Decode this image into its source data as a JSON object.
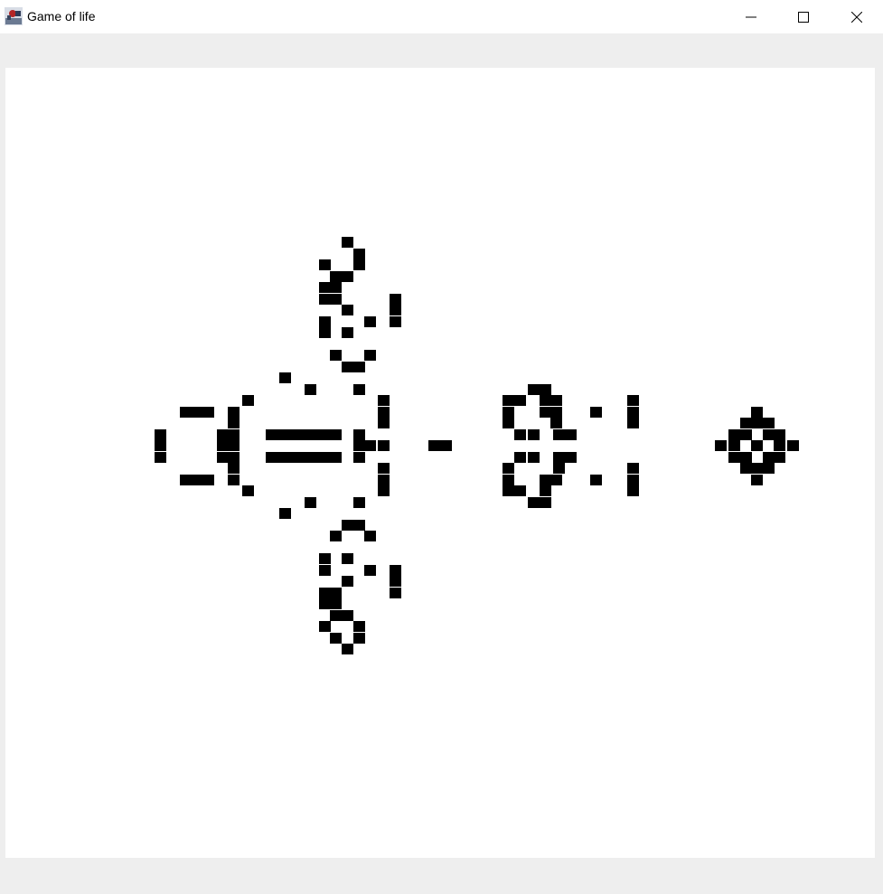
{
  "window": {
    "title": "Game of life",
    "icon": "java-app-icon",
    "controls": [
      "minimize-icon",
      "maximize-icon",
      "close-icon"
    ]
  },
  "board": {
    "live_color": "#000000",
    "dead_color": "#ffffff",
    "live_cells": [
      [
        384,
        268
      ],
      [
        359,
        293
      ],
      [
        397,
        281
      ],
      [
        397,
        293
      ],
      [
        371,
        306
      ],
      [
        384,
        306
      ],
      [
        359,
        318
      ],
      [
        359,
        331
      ],
      [
        371,
        318
      ],
      [
        371,
        331
      ],
      [
        384,
        343
      ],
      [
        359,
        356
      ],
      [
        359,
        368
      ],
      [
        384,
        368
      ],
      [
        409,
        356
      ],
      [
        437,
        331
      ],
      [
        437,
        343
      ],
      [
        437,
        356
      ],
      [
        371,
        393
      ],
      [
        384,
        406
      ],
      [
        397,
        406
      ],
      [
        409,
        393
      ],
      [
        315,
        418
      ],
      [
        343,
        431
      ],
      [
        397,
        431
      ],
      [
        274,
        443
      ],
      [
        424,
        443
      ],
      [
        424,
        456
      ],
      [
        424,
        468
      ],
      [
        205,
        456
      ],
      [
        218,
        456
      ],
      [
        230,
        456
      ],
      [
        258,
        456
      ],
      [
        258,
        468
      ],
      [
        177,
        481
      ],
      [
        177,
        493
      ],
      [
        177,
        506
      ],
      [
        246,
        481
      ],
      [
        258,
        481
      ],
      [
        246,
        493
      ],
      [
        258,
        493
      ],
      [
        246,
        506
      ],
      [
        258,
        506
      ],
      [
        300,
        481
      ],
      [
        312,
        481
      ],
      [
        324,
        481
      ],
      [
        336,
        481
      ],
      [
        348,
        481
      ],
      [
        360,
        481
      ],
      [
        371,
        481
      ],
      [
        300,
        506
      ],
      [
        312,
        506
      ],
      [
        324,
        506
      ],
      [
        336,
        506
      ],
      [
        348,
        506
      ],
      [
        360,
        506
      ],
      [
        371,
        506
      ],
      [
        397,
        481
      ],
      [
        397,
        493
      ],
      [
        397,
        506
      ],
      [
        409,
        493
      ],
      [
        424,
        493
      ],
      [
        480,
        493
      ],
      [
        493,
        493
      ],
      [
        205,
        531
      ],
      [
        218,
        531
      ],
      [
        230,
        531
      ],
      [
        258,
        518
      ],
      [
        258,
        531
      ],
      [
        274,
        543
      ],
      [
        424,
        518
      ],
      [
        424,
        531
      ],
      [
        424,
        543
      ],
      [
        343,
        556
      ],
      [
        397,
        556
      ],
      [
        315,
        568
      ],
      [
        384,
        581
      ],
      [
        397,
        581
      ],
      [
        371,
        593
      ],
      [
        409,
        593
      ],
      [
        359,
        618
      ],
      [
        359,
        631
      ],
      [
        384,
        618
      ],
      [
        409,
        631
      ],
      [
        384,
        643
      ],
      [
        437,
        631
      ],
      [
        437,
        643
      ],
      [
        437,
        656
      ],
      [
        359,
        656
      ],
      [
        359,
        668
      ],
      [
        371,
        656
      ],
      [
        371,
        668
      ],
      [
        371,
        681
      ],
      [
        384,
        681
      ],
      [
        359,
        693
      ],
      [
        397,
        693
      ],
      [
        397,
        706
      ],
      [
        371,
        706
      ],
      [
        384,
        718
      ],
      [
        590,
        431
      ],
      [
        603,
        431
      ],
      [
        562,
        443
      ],
      [
        575,
        443
      ],
      [
        603,
        443
      ],
      [
        615,
        443
      ],
      [
        562,
        456
      ],
      [
        603,
        456
      ],
      [
        615,
        456
      ],
      [
        562,
        468
      ],
      [
        615,
        468
      ],
      [
        575,
        481
      ],
      [
        590,
        481
      ],
      [
        618,
        481
      ],
      [
        631,
        481
      ],
      [
        575,
        506
      ],
      [
        590,
        506
      ],
      [
        618,
        506
      ],
      [
        631,
        506
      ],
      [
        562,
        518
      ],
      [
        618,
        518
      ],
      [
        562,
        531
      ],
      [
        603,
        531
      ],
      [
        615,
        531
      ],
      [
        562,
        543
      ],
      [
        575,
        543
      ],
      [
        603,
        543
      ],
      [
        590,
        556
      ],
      [
        603,
        556
      ],
      [
        659,
        456
      ],
      [
        659,
        531
      ],
      [
        700,
        443
      ],
      [
        700,
        456
      ],
      [
        700,
        468
      ],
      [
        700,
        518
      ],
      [
        700,
        531
      ],
      [
        700,
        543
      ],
      [
        837,
        456
      ],
      [
        825,
        468
      ],
      [
        837,
        468
      ],
      [
        850,
        468
      ],
      [
        812,
        481
      ],
      [
        825,
        481
      ],
      [
        850,
        481
      ],
      [
        862,
        481
      ],
      [
        797,
        493
      ],
      [
        812,
        493
      ],
      [
        837,
        493
      ],
      [
        862,
        493
      ],
      [
        877,
        493
      ],
      [
        812,
        506
      ],
      [
        825,
        506
      ],
      [
        850,
        506
      ],
      [
        862,
        506
      ],
      [
        825,
        518
      ],
      [
        837,
        518
      ],
      [
        850,
        518
      ],
      [
        837,
        531
      ]
    ]
  }
}
